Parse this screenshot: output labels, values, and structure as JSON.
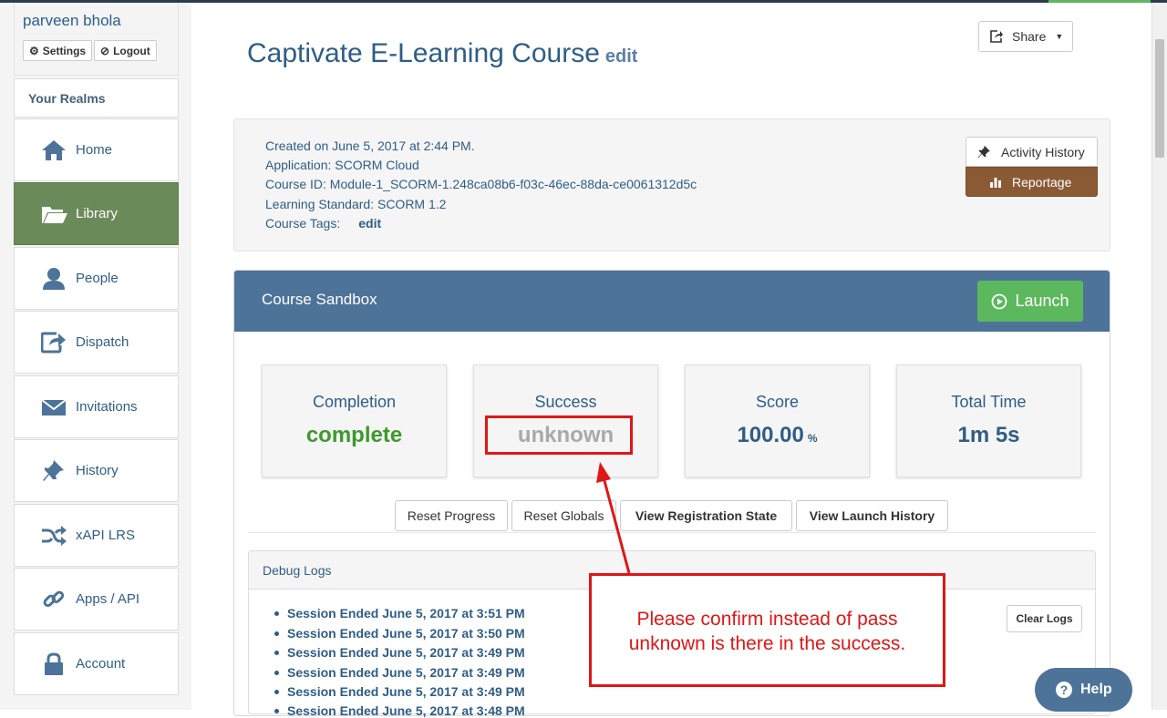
{
  "user": {
    "name": "parveen bhola",
    "settings_label": "Settings",
    "logout_label": "Logout"
  },
  "sidebar": {
    "realms_label": "Your Realms",
    "items": [
      {
        "label": "Home",
        "icon": "home-icon"
      },
      {
        "label": "Library",
        "icon": "folder-open-icon",
        "active": true
      },
      {
        "label": "People",
        "icon": "user-icon"
      },
      {
        "label": "Dispatch",
        "icon": "share-icon"
      },
      {
        "label": "Invitations",
        "icon": "envelope-icon"
      },
      {
        "label": "History",
        "icon": "pushpin-icon"
      },
      {
        "label": "xAPI LRS",
        "icon": "random-icon"
      },
      {
        "label": "Apps / API",
        "icon": "link-icon"
      },
      {
        "label": "Account",
        "icon": "lock-icon"
      }
    ],
    "active_color": "#6b8a5a"
  },
  "header": {
    "title": "Captivate E-Learning Course",
    "edit_label": "edit",
    "share_label": "Share"
  },
  "info": {
    "created": "Created on June 5, 2017 at 2:44 PM.",
    "application": "Application: SCORM Cloud",
    "course_id": "Course ID: Module-1_SCORM-1.248ca08b6-f03c-46ec-88da-ce0061312d5c",
    "standard": "Learning Standard: SCORM 1.2",
    "tags_label": "Course Tags:",
    "tags_edit": "edit",
    "activity_history_label": "Activity History",
    "reportage_label": "Reportage"
  },
  "sandbox": {
    "title": "Course Sandbox",
    "launch_label": "Launch",
    "header_color": "#4d7398",
    "stats": [
      {
        "label": "Completion",
        "value": "complete"
      },
      {
        "label": "Success",
        "value": "unknown"
      },
      {
        "label": "Score",
        "value": "100.00",
        "unit": "%"
      },
      {
        "label": "Total Time",
        "value": "1m 5s"
      }
    ],
    "actions": {
      "reset_progress": "Reset Progress",
      "reset_globals": "Reset Globals",
      "view_registration_state": "View Registration State",
      "view_launch_history": "View Launch History"
    }
  },
  "debug": {
    "title": "Debug Logs",
    "clear_label": "Clear Logs",
    "logs": [
      "Session Ended June 5, 2017 at 3:51 PM",
      "Session Ended June 5, 2017 at 3:50 PM",
      "Session Ended June 5, 2017 at 3:49 PM",
      "Session Ended June 5, 2017 at 3:49 PM",
      "Session Ended June 5, 2017 at 3:49 PM",
      "Session Ended June 5, 2017 at 3:48 PM"
    ]
  },
  "annotation": {
    "callout_line1": "Please confirm instead of pass",
    "callout_line2": "unknown is there in the success.",
    "color": "#e01616"
  },
  "help": {
    "label": "Help"
  }
}
